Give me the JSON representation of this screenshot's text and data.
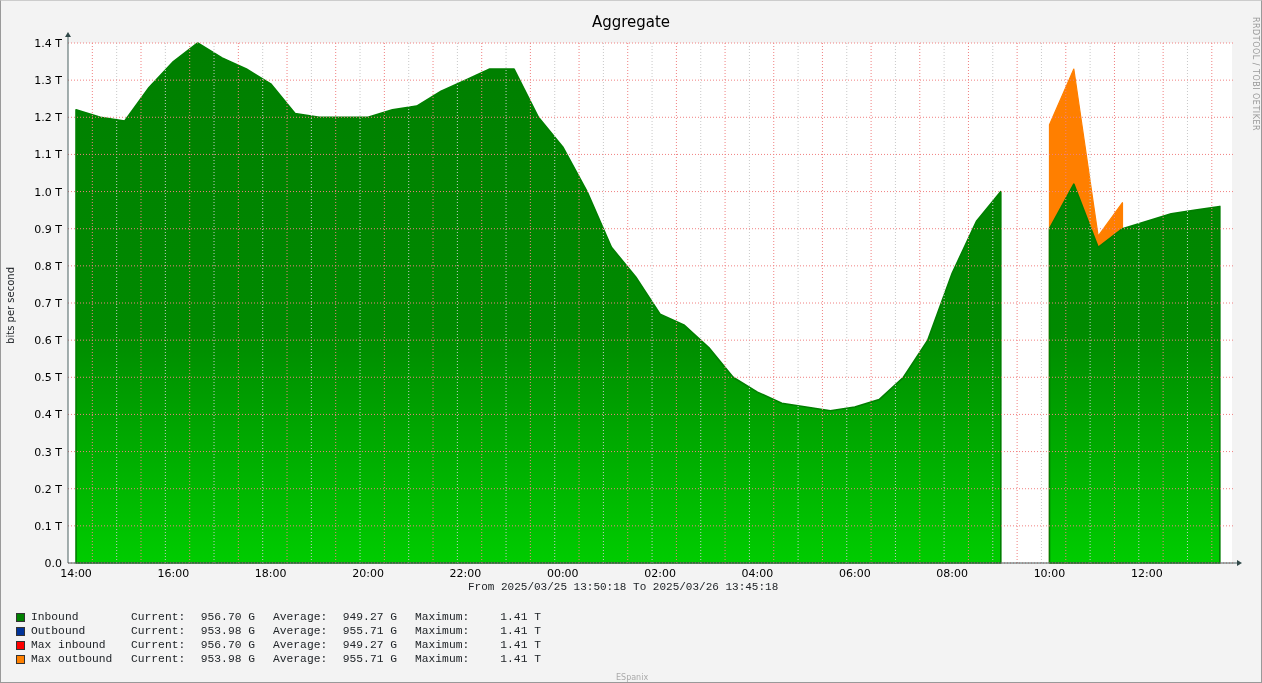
{
  "side_text": "RRDTOOL / TOBI OETIKER",
  "chart_data": {
    "type": "area",
    "title": "Aggregate",
    "ylabel": "bits per second",
    "categories": [
      "14:00",
      null,
      null,
      null,
      "16:00",
      null,
      null,
      null,
      "18:00",
      null,
      null,
      null,
      "20:00",
      null,
      null,
      null,
      "22:00",
      null,
      null,
      null,
      "00:00",
      null,
      null,
      null,
      "02:00",
      null,
      null,
      null,
      "04:00",
      null,
      null,
      null,
      "06:00",
      null,
      null,
      null,
      "08:00",
      null,
      null,
      null,
      "10:00",
      null,
      null,
      null,
      "12:00",
      null,
      null,
      null
    ],
    "ylim": [
      0,
      1.4
    ],
    "grid": true,
    "yticks": [
      {
        "value": 0,
        "label": "0.0"
      },
      {
        "value": 0.1,
        "label": "0.1 T"
      },
      {
        "value": 0.2,
        "label": "0.2 T"
      },
      {
        "value": 0.3,
        "label": "0.3 T"
      },
      {
        "value": 0.4,
        "label": "0.4 T"
      },
      {
        "value": 0.5,
        "label": "0.5 T"
      },
      {
        "value": 0.6,
        "label": "0.6 T"
      },
      {
        "value": 0.7,
        "label": "0.7 T"
      },
      {
        "value": 0.8,
        "label": "0.8 T"
      },
      {
        "value": 0.9,
        "label": "0.9 T"
      },
      {
        "value": 1.0,
        "label": "1.0 T"
      },
      {
        "value": 1.1,
        "label": "1.1 T"
      },
      {
        "value": 1.2,
        "label": "1.2 T"
      },
      {
        "value": 1.3,
        "label": "1.3 T"
      },
      {
        "value": 1.4,
        "label": "1.4 T"
      }
    ],
    "series": [
      {
        "color": "#007f00",
        "values": [
          1.22,
          1.2,
          1.19,
          1.28,
          1.35,
          1.4,
          1.36,
          1.33,
          1.29,
          1.21,
          1.2,
          1.2,
          1.2,
          1.22,
          1.23,
          1.27,
          1.3,
          1.33,
          1.33,
          1.2,
          1.12,
          1.0,
          0.85,
          0.77,
          0.67,
          0.64,
          0.58,
          0.5,
          0.46,
          0.43,
          0.42,
          0.41,
          0.42,
          0.44,
          0.5,
          0.6,
          0.78,
          0.92,
          1.0,
          null,
          0.9,
          1.02,
          0.85,
          0.9,
          0.92,
          0.94,
          0.95,
          0.96
        ]
      },
      {
        "color": "#ff7f00",
        "values": [
          null,
          null,
          null,
          null,
          null,
          null,
          null,
          null,
          null,
          null,
          null,
          null,
          null,
          null,
          null,
          null,
          null,
          null,
          null,
          null,
          null,
          null,
          null,
          null,
          null,
          null,
          null,
          null,
          null,
          null,
          null,
          null,
          null,
          null,
          null,
          null,
          null,
          null,
          null,
          null,
          1.18,
          1.33,
          0.88,
          0.97,
          null,
          null,
          null,
          null
        ]
      }
    ]
  },
  "range_text": "From 2025/03/25 13:50:18 To 2025/03/26 13:45:18",
  "legend": [
    {
      "name": "Inbound",
      "color": "#008000",
      "current_label": "Current:",
      "current": "956.70 G",
      "average_label": "Average:",
      "average": "949.27 G",
      "maximum_label": "Maximum:",
      "maximum": "1.41 T"
    },
    {
      "name": "Outbound",
      "color": "#003399",
      "current_label": "Current:",
      "current": "953.98 G",
      "average_label": "Average:",
      "average": "955.71 G",
      "maximum_label": "Maximum:",
      "maximum": "1.41 T"
    },
    {
      "name": "Max inbound",
      "color": "#ff0000",
      "current_label": "Current:",
      "current": "956.70 G",
      "average_label": "Average:",
      "average": "949.27 G",
      "maximum_label": "Maximum:",
      "maximum": "1.41 T"
    },
    {
      "name": "Max outbound",
      "color": "#ff8000",
      "current_label": "Current:",
      "current": "953.98 G",
      "average_label": "Average:",
      "average": "955.71 G",
      "maximum_label": "Maximum:",
      "maximum": "1.41 T"
    }
  ],
  "footer": "ESpanix"
}
